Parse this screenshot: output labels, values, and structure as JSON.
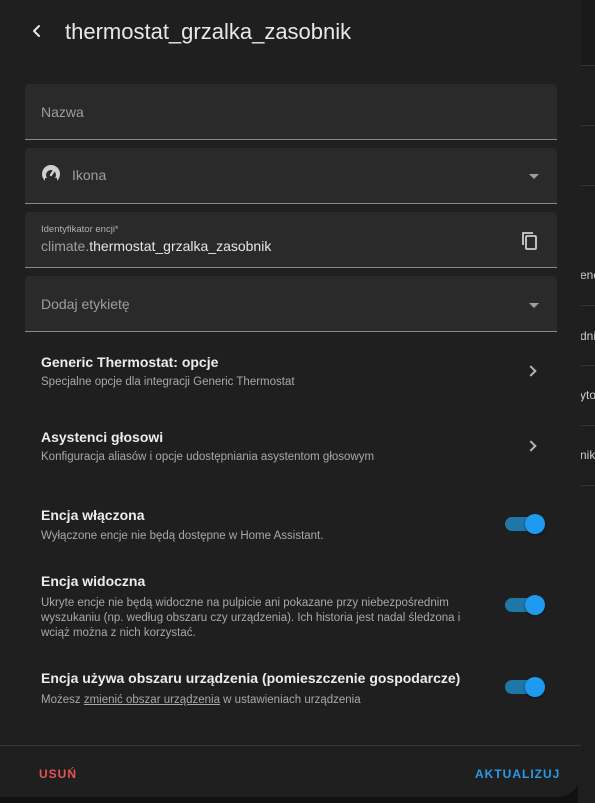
{
  "dialog": {
    "title": "thermostat_grzalka_zasobnik"
  },
  "form": {
    "name_label": "Nazwa",
    "icon_label": "Ikona",
    "entity_id": {
      "label": "Identyfikator encji*",
      "prefix": "climate.",
      "value": "thermostat_grzalka_zasobnik"
    },
    "labels_label": "Dodaj etykietę"
  },
  "nav": [
    {
      "title": "Generic Thermostat: opcje",
      "subtitle": "Specjalne opcje dla integracji Generic Thermostat"
    },
    {
      "title": "Asystenci głosowi",
      "subtitle": "Konfiguracja aliasów i opcje udostępniania asystentom głosowym"
    }
  ],
  "toggles": [
    {
      "title": "Encja włączona",
      "subtitle": "Wyłączone encje nie będą dostępne w Home Assistant.",
      "state": true
    },
    {
      "title": "Encja widoczna",
      "subtitle": "Ukryte encje nie będą widoczne na pulpicie ani pokazane przy niebezpośrednim wyszukaniu (np. według obszaru czy urządzenia). Ich historia jest nadal śledzona i wciąż można z nich korzystać.",
      "state": true
    },
    {
      "title": "Encja używa obszaru urządzenia (pomieszczenie gospodarcze)",
      "subtitle_before": "Możesz ",
      "subtitle_link": "zmienić obszar urządzenia",
      "subtitle_after": " w ustawieniach urządzenia",
      "state": true
    }
  ],
  "footer": {
    "delete_label": "USUŃ",
    "update_label": "AKTUALIZUJ"
  },
  "background": {
    "snippets": [
      "ene",
      "dni",
      "yto",
      "nik"
    ]
  },
  "colors": {
    "accent": "#1e9bf0",
    "danger": "#e35454",
    "surface": "#2a2a2a"
  },
  "icons": {
    "back": "arrow-left-icon",
    "field_icon": "gauge-icon",
    "copy": "copy-icon",
    "dropdown": "chevron-down-icon",
    "nav": "chevron-right-icon"
  }
}
